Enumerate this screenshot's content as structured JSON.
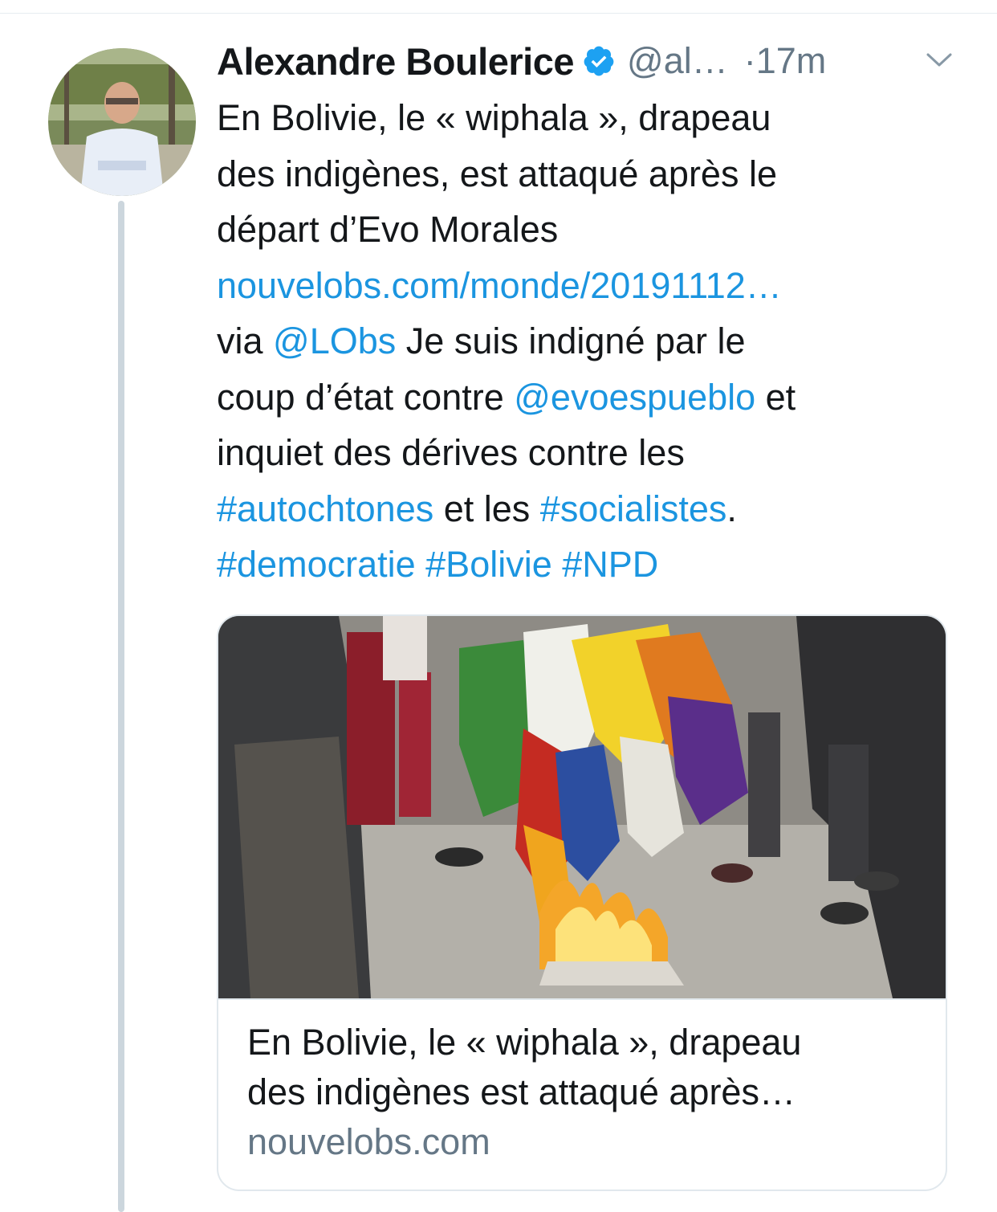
{
  "tweet": {
    "author_name": "Alexandre Boulerice",
    "handle": "@al…",
    "timestamp": "·17m",
    "text_lines": {
      "l1": "En Bolivie, le « wiphala », drapeau",
      "l2": "des indigènes, est attaqué après le",
      "l3": "départ d’Evo Morales",
      "link_url": "nouvelobs.com/monde/20191112…",
      "l5_a": "via ",
      "mention_lobs": "@LObs",
      "l5_b": " Je suis indigné par le",
      "l6_a": "coup d’état contre ",
      "mention_evo": "@evoespueblo",
      "l6_b": " et",
      "l7": "inquiet des dérives contre les",
      "hashtag_autochtones": "#autochtones",
      "l8_mid": " et les ",
      "hashtag_socialistes": "#socialistes",
      "l8_end": ".",
      "hashtag_democratie": "#democratie",
      "hashtag_bolivie": "#Bolivie",
      "hashtag_npd": "#NPD"
    }
  },
  "card": {
    "title_line1": "En Bolivie, le « wiphala », drapeau",
    "title_line2": "des indigènes est attaqué après…",
    "domain": "nouvelobs.com"
  },
  "colors": {
    "link": "#1b95e0",
    "verified": "#1da1f2",
    "secondary_text": "#657786",
    "thread_line": "#ccd6dd"
  },
  "icons": {
    "verified": "verified-badge-icon",
    "chevron": "chevron-down-icon"
  }
}
